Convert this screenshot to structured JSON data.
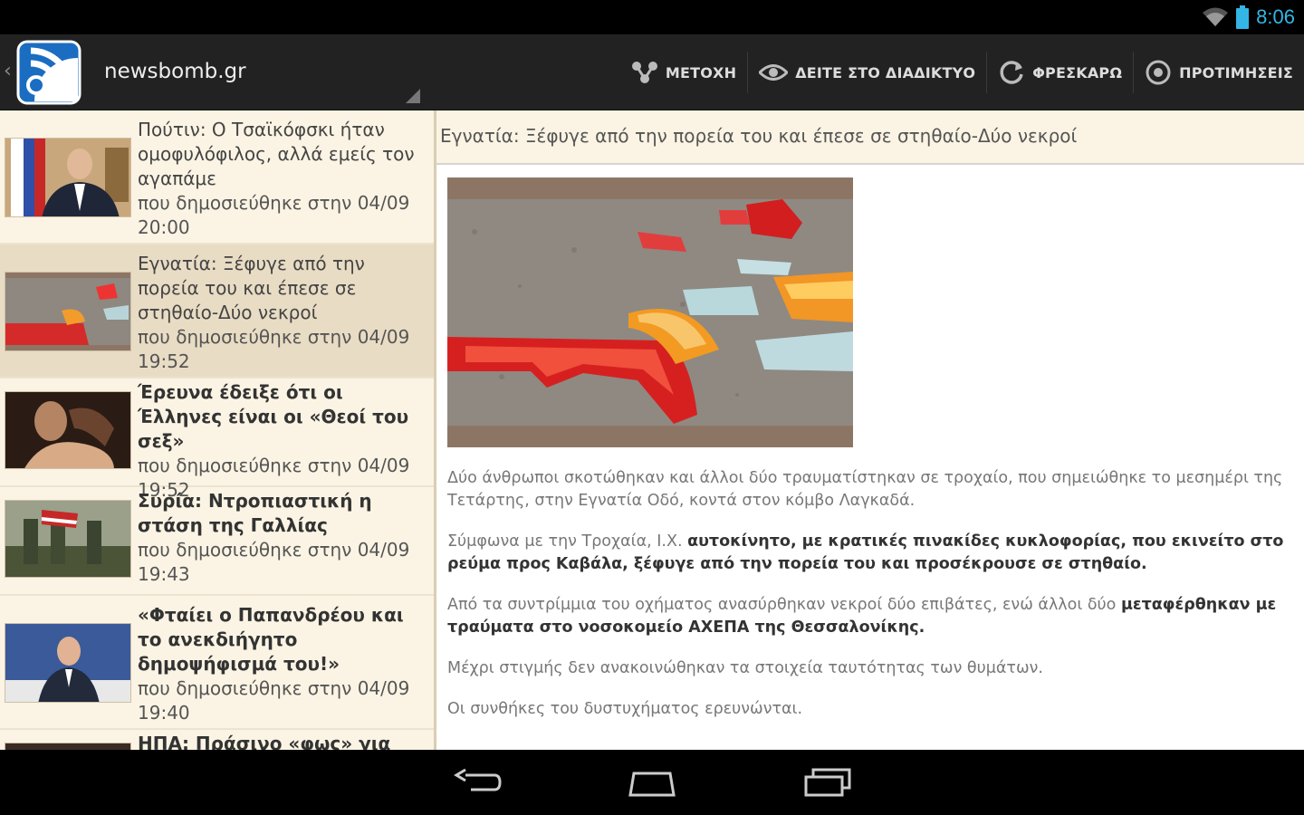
{
  "status_bar": {
    "time": "8:06"
  },
  "app": {
    "title": "newsbomb.gr"
  },
  "actions": [
    {
      "label": "ΜΕΤΟΧΗ",
      "icon": "share-icon"
    },
    {
      "label": "ΔΕΙΤΕ ΣΤΟ ΔΙΑΔΙΚΤΥΟ",
      "icon": "eye-icon"
    },
    {
      "label": "ΦΡΕΣΚΑΡΩ",
      "icon": "refresh-icon"
    },
    {
      "label": "ΠΡΟΤΙΜΗΣΕΙΣ",
      "icon": "settings-icon"
    }
  ],
  "list": [
    {
      "title": "Πούτιν: Ο Τσαϊκόφσκι ήταν ομοφυλόφιλος, αλλά εμείς τον αγαπάμε",
      "meta": "που δημοσιεύθηκε στην 04/09 20:00",
      "bold": false,
      "selected": false
    },
    {
      "title": "Εγνατία: Ξέφυγε από την πορεία του και έπεσε σε στηθαίο-Δύο νεκροί",
      "meta": "που δημοσιεύθηκε στην 04/09 19:52",
      "bold": false,
      "selected": true
    },
    {
      "title": "Έρευνα έδειξε ότι οι Έλληνες είναι οι «Θεοί του σεξ»",
      "meta": "που δημοσιεύθηκε στην 04/09 19:52",
      "bold": true,
      "selected": false
    },
    {
      "title": "Συρία: Ντροπιαστική η στάση της Γαλλίας",
      "meta": "που δημοσιεύθηκε στην 04/09 19:43",
      "bold": true,
      "selected": false
    },
    {
      "title": "«Φταίει ο Παπανδρέου και το ανεκδιήγητο δημοψήφισμά του!»",
      "meta": "που δημοσιεύθηκε στην 04/09 19:40",
      "bold": true,
      "selected": false
    },
    {
      "title": "ΗΠΑ: Πράσινο «φως» για",
      "meta": "",
      "bold": true,
      "selected": false
    }
  ],
  "article": {
    "title": "Εγνατία: Ξέφυγε από την πορεία του και έπεσε σε στηθαίο-Δύο νεκροί",
    "p1": "Δύο άνθρωποι σκοτώθηκαν και άλλοι δύο τραυματίστηκαν σε τροχαίο, που σημειώθηκε το μεσημέρι της Τετάρτης, στην Εγνατία Οδό, κοντά στον κόμβο Λαγκαδά.",
    "p2_a": "Σύμφωνα με την Τροχαία, Ι.Χ. ",
    "p2_b": "αυτοκίνητο, με κρατικές πινακίδες κυκλοφορίας, που εκινείτο στο ρεύμα προς Καβάλα, ξέφυγε από την πορεία του και προσέκρουσε σε στηθαίο.",
    "p3_a": "Από τα συντρίμμια του οχήματος ανασύρθηκαν νεκροί δύο επιβάτες, ενώ άλλοι δύο ",
    "p3_b": "μεταφέρθηκαν με τραύματα στο νοσοκομείο ΑΧΕΠΑ της Θεσσαλονίκης.",
    "p4": "Μέχρι στιγμής δεν ανακοινώθηκαν τα στοιχεία ταυτότητας των θυμάτων.",
    "p5": "Οι συνθήκες του δυστυχήματος ερευνώνται."
  },
  "colors": {
    "accent": "#33b5e5",
    "action_bar": "#222222",
    "list_bg": "#fbf4e4",
    "list_selected": "#e9dcc4"
  }
}
